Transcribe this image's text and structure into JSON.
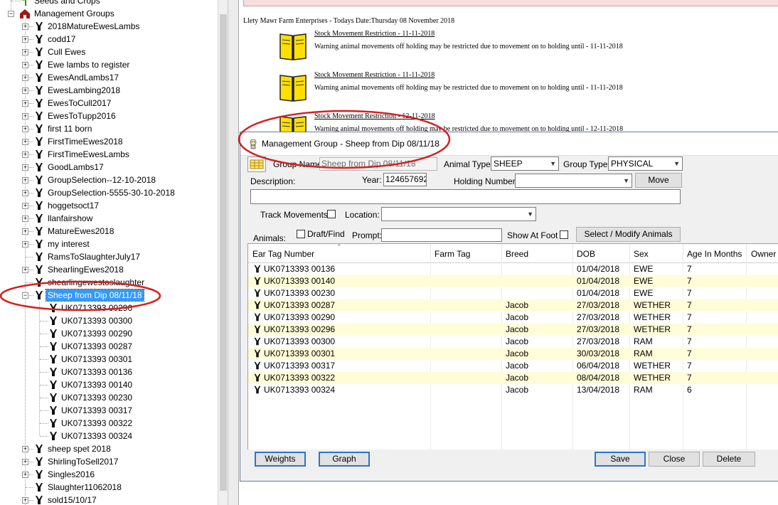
{
  "tree": {
    "top_partial": "Seeds and Crops",
    "group_root": "Management Groups",
    "groups": [
      {
        "label": "2018MatureEwesLambs",
        "expand": "+"
      },
      {
        "label": "codd17",
        "expand": "+"
      },
      {
        "label": "Cull Ewes",
        "expand": "+"
      },
      {
        "label": "Ewe lambs to register",
        "expand": "+"
      },
      {
        "label": "EwesAndLambs17",
        "expand": "+"
      },
      {
        "label": "EwesLambing2018",
        "expand": "+"
      },
      {
        "label": "EwesToCull2017",
        "expand": "+"
      },
      {
        "label": "EwesToTupp2016",
        "expand": "+"
      },
      {
        "label": "first 11 born",
        "expand": "+"
      },
      {
        "label": "FirstTimeEwes2018",
        "expand": "+"
      },
      {
        "label": "FirstTimeEwesLambs",
        "expand": "+"
      },
      {
        "label": "GoodLambs17",
        "expand": "+"
      },
      {
        "label": "GroupSelection--12-10-2018",
        "expand": "+"
      },
      {
        "label": "GroupSelection-5555-30-10-2018",
        "expand": "+"
      },
      {
        "label": "hoggetsoct17",
        "expand": "+"
      },
      {
        "label": "llanfairshow",
        "expand": "+"
      },
      {
        "label": "MatureEwes2018",
        "expand": "+"
      },
      {
        "label": "my interest",
        "expand": "+"
      },
      {
        "label": "RamsToSlaughterJuly17",
        "expand": ""
      },
      {
        "label": "ShearlingEwes2018",
        "expand": "+"
      },
      {
        "label": "shearlingewestoslaughter",
        "expand": ""
      },
      {
        "label": "Sheep from Dip 08/11/18",
        "expand": "-",
        "selected": true
      }
    ],
    "children": [
      "UK0713393 00296",
      "UK0713393 00300",
      "UK0713393 00290",
      "UK0713393 00287",
      "UK0713393 00301",
      "UK0713393 00136",
      "UK0713393 00140",
      "UK0713393 00230",
      "UK0713393 00317",
      "UK0713393 00322",
      "UK0713393 00324"
    ],
    "after": [
      {
        "label": "sheep spet 2018",
        "expand": "+"
      },
      {
        "label": "ShirlingToSell2017",
        "expand": "+"
      },
      {
        "label": "Singles2016",
        "expand": "+"
      },
      {
        "label": "Slaughter11062018",
        "expand": ""
      },
      {
        "label": "sold15/10/17",
        "expand": "+"
      }
    ]
  },
  "page": {
    "header": "Llety Mawr Farm Enterprises - Todays Date:Thursday 08 November 2018",
    "notices": [
      {
        "title": "Stock Movement Restriction - 11-11-2018",
        "body": "Warning animal movements off holding may be restricted due to movement on to holding until - 11-11-2018"
      },
      {
        "title": "Stock Movement Restriction - 11-11-2018",
        "body": "Warning animal movements off holding may be restricted due to movement on to holding until - 11-11-2018"
      },
      {
        "title": "Stock Movement Restriction - 12-11-2018",
        "body": "Warning animal movements off holding may be restricted due to movement on to holding until - 12-11-2018"
      }
    ]
  },
  "dialog": {
    "title": "Management Group - Sheep from Dip 08/11/18",
    "group_name_label": "Group Name:",
    "group_name_value": "Sheep from Dip 08/11/18",
    "animal_type_label": "Animal Type:",
    "animal_type_value": "SHEEP",
    "group_type_label": "Group Type:",
    "group_type_value": "PHYSICAL",
    "description_label": "Description:",
    "year_label": "Year:",
    "year_value": "124657692",
    "holding_label": "Holding Number:",
    "holding_value": "",
    "move_button": "Move",
    "description_value": "",
    "track_label": "Track Movements:",
    "location_label": "Location:",
    "location_value": "",
    "animals_label": "Animals:",
    "draft_label": "Draft/Find",
    "prompt_label": "Prompt:",
    "prompt_value": "",
    "show_at_foot_label": "Show At Foot",
    "select_modify_button": "Select / Modify Animals",
    "columns": [
      "Ear Tag Number",
      "Farm Tag",
      "Breed",
      "DOB",
      "Sex",
      "Age In Months",
      "Owner"
    ],
    "rows": [
      [
        "UK0713393 00136",
        "",
        "",
        "01/04/2018",
        "EWE",
        "7",
        ""
      ],
      [
        "UK0713393 00140",
        "",
        "",
        "01/04/2018",
        "EWE",
        "7",
        ""
      ],
      [
        "UK0713393 00230",
        "",
        "",
        "01/04/2018",
        "EWE",
        "7",
        ""
      ],
      [
        "UK0713393 00287",
        "",
        "Jacob",
        "27/03/2018",
        "WETHER",
        "7",
        ""
      ],
      [
        "UK0713393 00290",
        "",
        "Jacob",
        "27/03/2018",
        "WETHER",
        "7",
        ""
      ],
      [
        "UK0713393 00296",
        "",
        "Jacob",
        "27/03/2018",
        "WETHER",
        "7",
        ""
      ],
      [
        "UK0713393 00300",
        "",
        "Jacob",
        "27/03/2018",
        "RAM",
        "7",
        ""
      ],
      [
        "UK0713393 00301",
        "",
        "Jacob",
        "30/03/2018",
        "RAM",
        "7",
        ""
      ],
      [
        "UK0713393 00317",
        "",
        "Jacob",
        "06/04/2018",
        "WETHER",
        "7",
        ""
      ],
      [
        "UK0713393 00322",
        "",
        "Jacob",
        "08/04/2018",
        "WETHER",
        "7",
        ""
      ],
      [
        "UK0713393 00324",
        "",
        "Jacob",
        "13/04/2018",
        "RAM",
        "6",
        ""
      ]
    ],
    "weights_button": "Weights",
    "graph_button": "Graph",
    "save_button": "Save",
    "close_button": "Close",
    "delete_button": "Delete"
  },
  "colors": {
    "annotation_red": "#d42020",
    "selected_blue": "#3399ff",
    "alt_row": "#fffdd8",
    "focus_border": "#2e74c8"
  },
  "icons": [
    "sheep-group-icon",
    "sheep-icon",
    "book-icon",
    "barn-icon",
    "plant-icon",
    "app-icon",
    "table-icon"
  ]
}
